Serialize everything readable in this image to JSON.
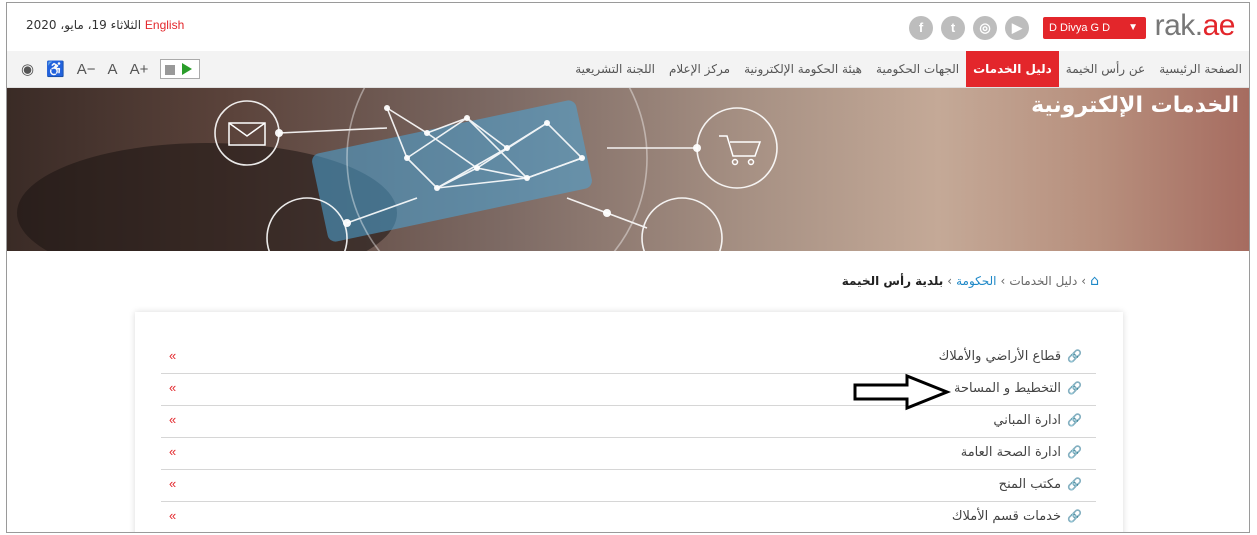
{
  "header": {
    "logo": {
      "prefix": "rak.",
      "suffix": "ae"
    },
    "user_button": "D Divya G D",
    "language_link": "English",
    "date": "الثلاثاء 19، مايو، 2020",
    "social_icons": [
      "youtube-icon",
      "instagram-icon",
      "twitter-icon",
      "facebook-icon"
    ]
  },
  "nav": {
    "items": [
      "الصفحة الرئيسية",
      "عن رأس الخيمة",
      "دليل الخدمات",
      "الجهات الحكومية",
      "هيئة الحكومة الإلكترونية",
      "مركز الإعلام",
      "اللجنة التشريعية"
    ],
    "active_index": 2,
    "tools": {
      "decrease": "A−",
      "normal": "A",
      "increase": "A+"
    }
  },
  "banner": {
    "title": "الخدمات الإلكترونية"
  },
  "breadcrumb": {
    "services": "دليل الخدمات",
    "government": "الحكومة",
    "current": "بلدية رأس الخيمة"
  },
  "list": {
    "items": [
      "قطاع الأراضي والأملاك",
      "التخطيط و المساحة",
      "ادارة المباني",
      "ادارة الصحة العامة",
      "مكتب المنح",
      "خدمات قسم الأملاك"
    ]
  },
  "colors": {
    "accent": "#e3262b",
    "link": "#1e88c7",
    "nav_bg": "#f3f3f3"
  }
}
